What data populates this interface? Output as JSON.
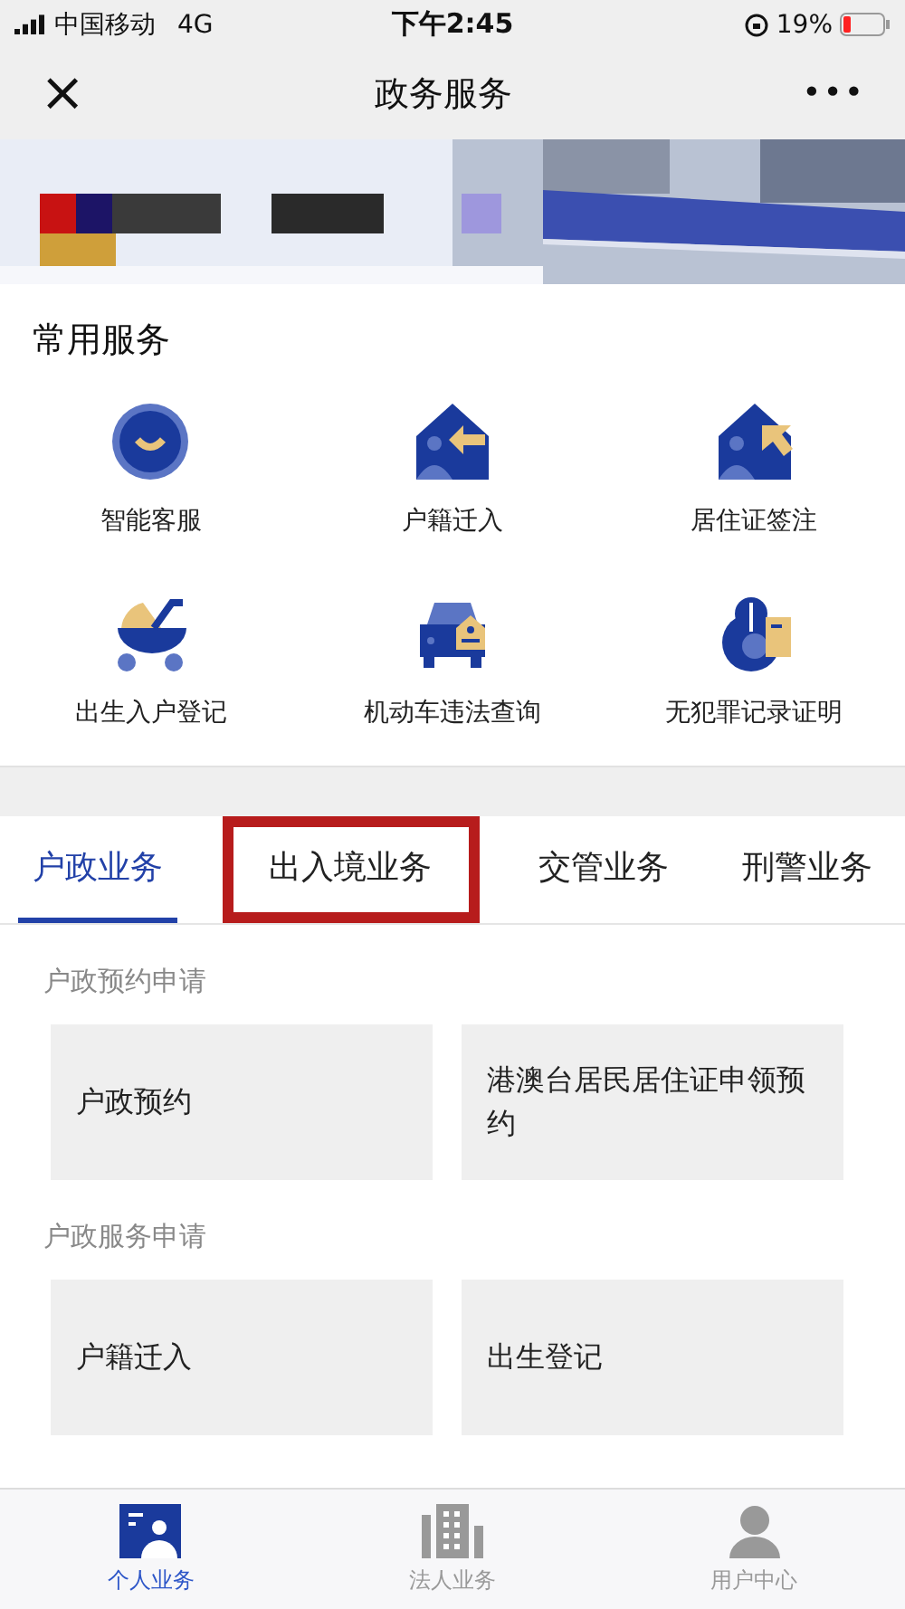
{
  "status_bar": {
    "carrier": "中国移动",
    "network": "4G",
    "time": "下午2:45",
    "battery": "19%"
  },
  "nav": {
    "close": "×",
    "title": "政务服务",
    "more": "•••"
  },
  "common_services": {
    "title": "常用服务",
    "items": [
      {
        "label": "智能客服"
      },
      {
        "label": "户籍迁入"
      },
      {
        "label": "居住证签注"
      },
      {
        "label": "出生入户登记"
      },
      {
        "label": "机动车违法查询"
      },
      {
        "label": "无犯罪记录证明"
      }
    ]
  },
  "tabs": [
    {
      "label": "户政业务",
      "selected": true,
      "highlighted": false
    },
    {
      "label": "出入境业务",
      "selected": false,
      "highlighted": true
    },
    {
      "label": "交管业务",
      "selected": false,
      "highlighted": false
    },
    {
      "label": "刑警业务",
      "selected": false,
      "highlighted": false
    }
  ],
  "sections": [
    {
      "title": "户政预约申请",
      "cards": [
        "户政预约",
        "港澳台居民居住证申领预约"
      ]
    },
    {
      "title": "户政服务申请",
      "cards": [
        "户籍迁入",
        "出生登记"
      ]
    }
  ],
  "bottom_tabs": [
    {
      "label": "个人业务",
      "selected": true
    },
    {
      "label": "法人业务",
      "selected": false
    },
    {
      "label": "用户中心",
      "selected": false
    }
  ]
}
